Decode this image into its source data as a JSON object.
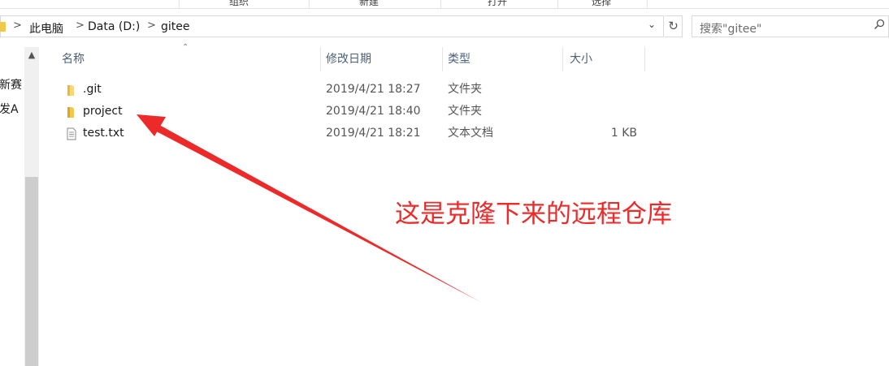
{
  "ribbon": {
    "groups": [
      "组织",
      "新建",
      "打开",
      "选择"
    ]
  },
  "address_bar": {
    "breadcrumbs": [
      "此电脑",
      "Data (D:)",
      "gitee"
    ],
    "separator": ">"
  },
  "search": {
    "placeholder": "搜索\"gitee\""
  },
  "nav_pane": {
    "items": [
      "新赛",
      "发A"
    ]
  },
  "columns": {
    "name": "名称",
    "date": "修改日期",
    "type": "类型",
    "size": "大小"
  },
  "files": [
    {
      "name": ".git",
      "date": "2019/4/21 18:27",
      "type": "文件夹",
      "size": "",
      "icon": "folder-icon"
    },
    {
      "name": "project",
      "date": "2019/4/21 18:40",
      "type": "文件夹",
      "size": "",
      "icon": "folder-icon"
    },
    {
      "name": "test.txt",
      "date": "2019/4/21 18:21",
      "type": "文本文档",
      "size": "1 KB",
      "icon": "text-file-icon"
    }
  ],
  "annotation": {
    "text": "这是克隆下来的远程仓库",
    "color": "#ec2a2a"
  },
  "colors": {
    "folder": "#f2c84b",
    "header_text": "#4c607a",
    "annotation": "#ec2a2a"
  }
}
